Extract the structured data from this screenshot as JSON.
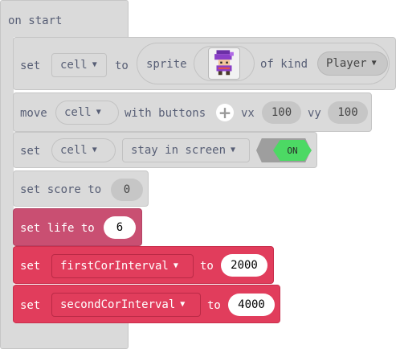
{
  "on_start": {
    "label": "on start"
  },
  "sprite_block": {
    "set_label": "set",
    "variable": "cell",
    "to_label": "to",
    "sprite_label": "sprite",
    "of_kind_label": "of kind",
    "kind": "Player"
  },
  "move_block": {
    "move_label": "move",
    "variable": "cell",
    "with_buttons_label": "with buttons",
    "vx_label": "vx",
    "vx": "100",
    "vy_label": "vy",
    "vy": "100"
  },
  "flag_block": {
    "set_label": "set",
    "variable": "cell",
    "flag": "stay in screen",
    "toggle": "ON"
  },
  "score_block": {
    "label": "set score to",
    "value": "0"
  },
  "life_block": {
    "label": "set life to",
    "value": "6"
  },
  "var_block_1": {
    "set_label": "set",
    "variable": "firstCorInterval",
    "to_label": "to",
    "value": "2000"
  },
  "var_block_2": {
    "set_label": "set",
    "variable": "secondCorInterval",
    "to_label": "to",
    "value": "4000"
  },
  "icons": {
    "dropdown": "chevron-down-icon",
    "add": "plus-icon",
    "sprite": "player-sprite-icon"
  },
  "colors": {
    "block_grey": "#dadada",
    "info_pink": "#c94f72",
    "variables_red": "#e13d5c",
    "toggle_green": "#4cd964"
  }
}
